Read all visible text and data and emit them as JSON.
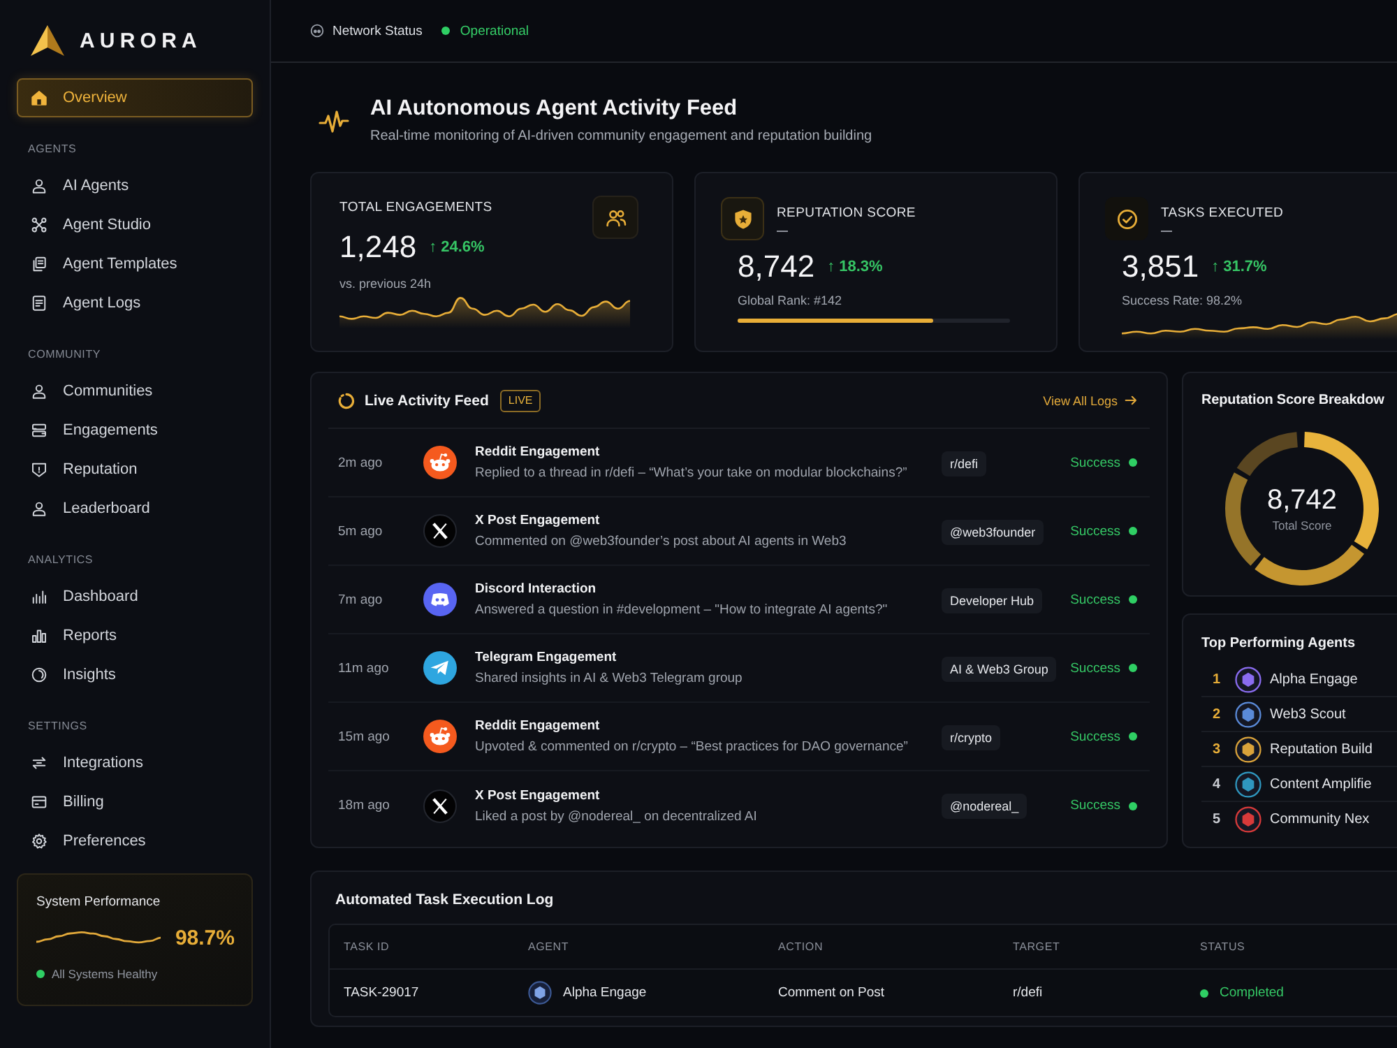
{
  "sidebar": {
    "logo": "AURORA",
    "groups": [
      {
        "items": [
          {
            "label": "Overview",
            "selected": true
          }
        ]
      },
      {
        "title": "AGENTS",
        "items": [
          {
            "label": "AI Agents",
            "selected": false
          },
          {
            "label": "Agent Studio",
            "selected": false
          },
          {
            "label": "Agent Templates",
            "selected": false
          },
          {
            "label": "Agent Logs",
            "selected": false
          }
        ]
      },
      {
        "title": "COMMUNITY",
        "items": [
          {
            "label": "Communities",
            "selected": false
          },
          {
            "label": "Engagements",
            "selected": false
          },
          {
            "label": "Reputation",
            "selected": false
          },
          {
            "label": "Leaderboard",
            "selected": false
          }
        ]
      },
      {
        "title": "ANALYTICS",
        "items": [
          {
            "label": "Dashboard",
            "selected": false
          },
          {
            "label": "Reports",
            "selected": false
          },
          {
            "label": "Insights",
            "selected": false
          }
        ]
      },
      {
        "title": "SETTINGS",
        "items": [
          {
            "label": "Integrations",
            "selected": false
          },
          {
            "label": "Billing",
            "selected": false
          },
          {
            "label": "Preferences",
            "selected": false
          }
        ]
      }
    ],
    "performance": {
      "title": "System Performance",
      "value": "98.7%",
      "status": "All Systems Healthy"
    }
  },
  "top_bar": {
    "label": "Network Status",
    "status": "Operational"
  },
  "header": {
    "title": "AI Autonomous Agent Activity Feed",
    "subtitle": "Real-time monitoring of AI-driven community engagement and reputation building"
  },
  "stats": [
    {
      "kind": "sparkline",
      "label": "TOTAL ENGAGEMENTS",
      "value": "1,248",
      "change": "↑ 24.6%",
      "note": "vs. previous 24h"
    },
    {
      "kind": "progress",
      "label": "REPUTATION SCORE",
      "value": "8,742",
      "change": "↑ 18.3%",
      "note": "Global Rank: #142",
      "level": 0.72
    },
    {
      "kind": "sparkline",
      "label": "TASKS EXECUTED",
      "value": "3,851",
      "change": "↑ 31.7%",
      "note": "Success Rate: 98.2%"
    }
  ],
  "activity_feed": {
    "title": "Live Activity Feed",
    "badge": "LIVE",
    "link": "View All Logs",
    "rows": [
      {
        "time": "2m ago",
        "kind": "reddit",
        "title": "Reddit Engagement",
        "description": "Replied to a thread in r/defi – “What’s your take on modular blockchains?”",
        "tag": "r/defi",
        "status": "Success"
      },
      {
        "time": "5m ago",
        "kind": "x",
        "title": "X Post Engagement",
        "description": "Commented on @web3founder’s post about AI agents in Web3",
        "tag": "@web3founder",
        "status": "Success"
      },
      {
        "time": "7m ago",
        "kind": "discord",
        "title": "Discord Interaction",
        "description": "Answered a question in #development – \"How to integrate AI agents?\"",
        "tag": "Developer Hub",
        "status": "Success"
      },
      {
        "time": "11m ago",
        "kind": "telegram",
        "title": "Telegram Engagement",
        "description": "Shared insights in AI & Web3 Telegram group",
        "tag": "AI & Web3 Group",
        "status": "Success"
      },
      {
        "time": "15m ago",
        "kind": "reddit",
        "title": "Reddit Engagement",
        "description": "Upvoted & commented on r/crypto – “Best practices for DAO governance”",
        "tag": "r/crypto",
        "status": "Success"
      },
      {
        "time": "18m ago",
        "kind": "x",
        "title": "X Post Engagement",
        "description": "Liked a post by @nodereal_ on decentralized AI",
        "tag": "@nodereal_",
        "status": "Success"
      }
    ]
  },
  "reputation_breakdown": {
    "title": "Reputation Score Breakdow",
    "value": "8,742",
    "caption": "Total Score"
  },
  "top_agents": {
    "title": "Top Performing Agents",
    "items": [
      {
        "rank": "1",
        "name": "Alpha Engage",
        "highlighted": true,
        "color": "#8a6cf0"
      },
      {
        "rank": "2",
        "name": "Web3 Scout",
        "highlighted": true,
        "color": "#5a8ad8"
      },
      {
        "rank": "3",
        "name": "Reputation Build",
        "highlighted": true,
        "color": "#d9a23a"
      },
      {
        "rank": "4",
        "name": "Content Amplifie",
        "highlighted": false,
        "color": "#2f97bf"
      },
      {
        "rank": "5",
        "name": "Community Nex",
        "highlighted": false,
        "color": "#d83a3a"
      }
    ]
  },
  "task_log": {
    "title": "Automated Task Execution Log",
    "columns": [
      "TASK ID",
      "AGENT",
      "ACTION",
      "TARGET",
      "STATUS"
    ],
    "rows": [
      {
        "cells": [
          "TASK-29017",
          "Alpha Engage",
          "Comment on Post",
          "r/defi",
          "Completed"
        ]
      }
    ]
  }
}
